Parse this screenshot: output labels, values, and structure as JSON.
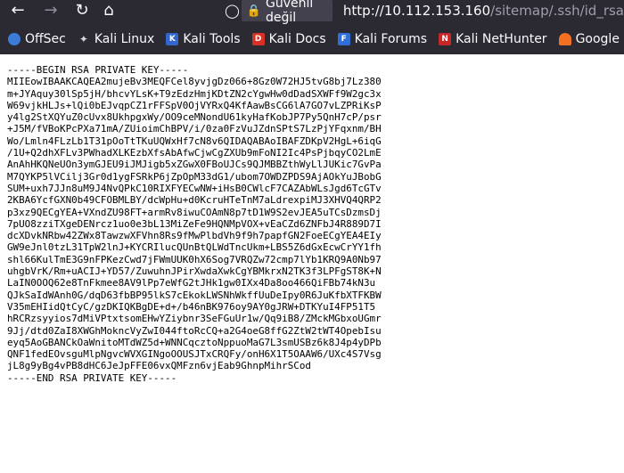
{
  "browser": {
    "security_label": "Güvenli değil",
    "url_host": "http://10.112.153.160",
    "url_path": "/sitemap/.ssh/id_rsa"
  },
  "bookmarks": [
    {
      "label": "OffSec",
      "icon": "offsec-icon",
      "color": "#3d7bd9"
    },
    {
      "label": "Kali Linux",
      "icon": "kali-dragon-icon",
      "color": "#d8d8d8"
    },
    {
      "label": "Kali Tools",
      "icon": "kali-tools-icon",
      "color": "#3366cc"
    },
    {
      "label": "Kali Docs",
      "icon": "kali-docs-icon",
      "color": "#d93025"
    },
    {
      "label": "Kali Forums",
      "icon": "kali-forums-icon",
      "color": "#2f6fd6"
    },
    {
      "label": "Kali NetHunter",
      "icon": "kali-nethunter-icon",
      "color": "#c62828"
    },
    {
      "label": "Google Hacking DB",
      "icon": "ghdb-icon",
      "color": "#f36f21"
    }
  ],
  "document": {
    "lines": [
      "-----BEGIN RSA PRIVATE KEY-----",
      "MIIEowIBAAKCAQEA2mujeBv3MEQFCel8yvjgDz066+8Gz0W72HJ5tvG8bj7Lz380",
      "m+JYAquy30lSp5jH/bhcvYLsK+T9zEdzHmjKDtZN2cYgwHw0dDadSXWFf9W2gc3x",
      "W69vjkHLJs+lQi0bEJvqpCZ1rFFSpV0OjVYRxQ4KfAawBsCG6lA7GO7vLZPRiKsP",
      "y4lg2StXQYuZ0cUvx8UkhpgxWy/OO9ceMNondU61kyHafKobJP7Py5QnH7cP/psr",
      "+J5M/fVBoKPcPXa71mA/ZUioimChBPV/i/0za0FzVuJZdnSPtS7LzPjYFqxnm/BH",
      "Wo/Lmln4FLzLb1T31pOoTtTKuUQWxHf7cN8v6QIDAQABAoIBAFZDKpV2HgL+6iqG",
      "/1U+Q2dhXFLv3PWhadXLKEzbXfsAbAfwCjwCgZXUb9mFoNI2Ic4PsPjbqyCO2LmE",
      "AnAhHKQNeUOn3ymGJEU9iJMJigb5xZGwX0FBoUJCs9QJMBBZthWyLlJUKic7GvPa",
      "M7QYKP5lVCilj3Gr0d1ygFSRkP6jZpOpM33dG1/ubom7OWDZPDS9AjAOkYuJBobG",
      "SUM+uxh7JJn8uM9J4NvQPkC10RIXFYECwNW+iHsB0CWlcF7CAZAbWLsJgd6TcGTv",
      "2KBA6YcfGXN0b49CFOBMLBY/dcWpHu+d0KcruHTeTnM7aLdrexpiMJ3XHVQ4QRP2",
      "p3xz9QECgYEA+VXndZU98FT+armRv8iwuCOAmN8p7tD1W9S2evJEA5uTCsDzmsDj",
      "7pUO8zziTXgeDENrcz1uo0e3bL13MiZeFe9HQNMpVOX+vEaCZd6ZNFbJ4R889D7I",
      "dcXDvkNRbw42ZWx8TawzwXFVhn8Rs9fMwPlbdVh9f9h7papfGN2FoeECgYEA4EIy",
      "GW9eJnl0tzL31TpW2lnJ+KYCRIlucQUnBtQLWdTncUkm+LBS5Z6dGxEcwCrYY1fh",
      "shl66KulTmE3G9nFPKezCwd7jFWmUUK0hX6Sog7VRQZw72cmp7lYb1KRQ9A0Nb97",
      "uhgbVrK/Rm+uACIJ+YD57/ZuwuhnJPirXwdaXwkCgYBMkrxN2TK3f3LPFgST8K+N",
      "LaIN0OOQ62e8TnFkmee8AV9lPp7eWfG2tJHk1gw0IXx4Da8oo466QiFBb74kN3u",
      "QJkSaIdWAnh0G/dqD63fbBP95lkS7cEkokLWSNhWkffUuDeIpy0R6JuKfbXTFKBW",
      "V35mEHIidQtCyC/gzDKIQKBgDE+d+/b46nBK976oy9AY0gJRW+DTKYuI4FP51T5",
      "hRCRzsyyios7dMiVPtxtsomEHwYZiybnr3SeFGuUr1w/Qq9iB8/ZMckMGbxoUGmr",
      "9Jj/dtd0ZaI8XWGhMokncVyZwI044ftoRcCQ+a2G4oeG8ffG2ZtW2tWT4OpebIsu",
      "eyq5AoGBANCkOaWnitoMTdWZ5d+WNNCqcztoNppuoMaG7L3smUSBz6k8J4p4yDPb",
      "QNF1fedEOvsguMlpNgvcWVXGINgoOOUSJTxCRQFy/onH6X1T5OAAW6/UXc4S7Vsg",
      "jL8g9yBg4vPB8dHC6JeJpFFE06vxQMFzn6vjEab9GhnpMihrSCod",
      "-----END RSA PRIVATE KEY-----"
    ]
  }
}
